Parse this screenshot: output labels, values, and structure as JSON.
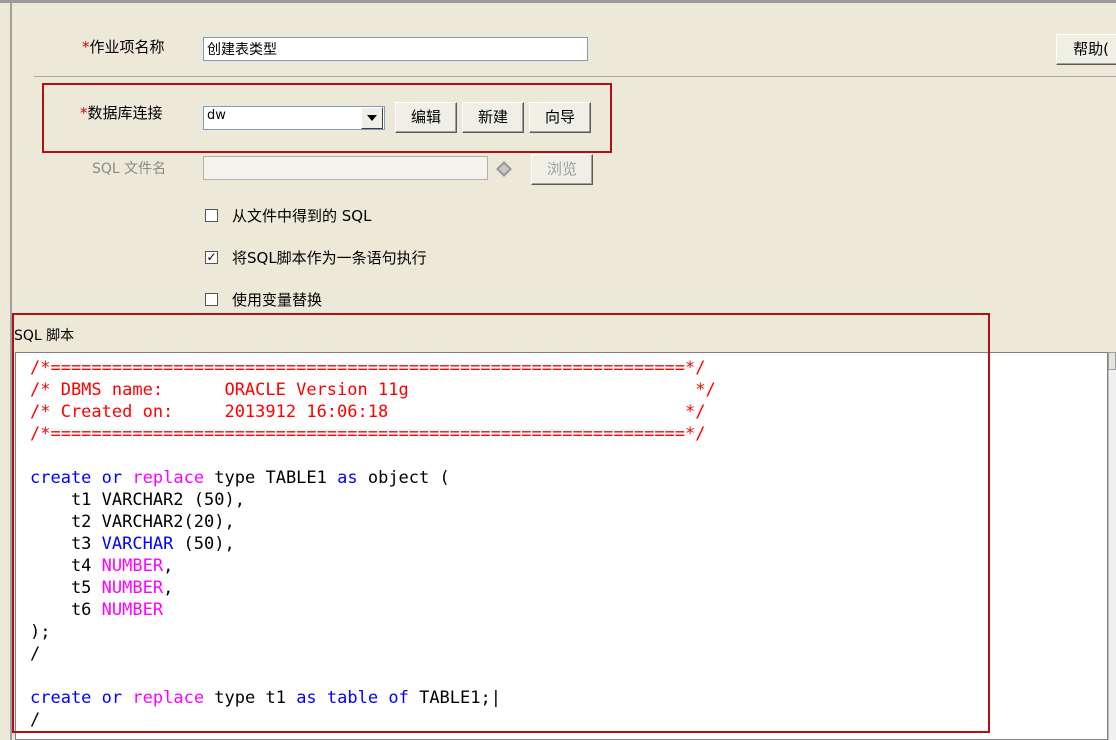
{
  "job": {
    "name_label": "作业项名称",
    "name_value": "创建表类型",
    "help_label": "帮助(",
    "required_mark": "*"
  },
  "db": {
    "label": "数据库连接",
    "selected": "dw",
    "edit_label": "编辑",
    "new_label": "新建",
    "wizard_label": "向导"
  },
  "sqlfile": {
    "label": "SQL 文件名",
    "value": "",
    "browse_label": "浏览"
  },
  "options": [
    {
      "label": "从文件中得到的 SQL",
      "checked": false
    },
    {
      "label": "将SQL脚本作为一条语句执行",
      "checked": true
    },
    {
      "label": "使用变量替换",
      "checked": false
    }
  ],
  "script": {
    "label": "SQL 脚本",
    "lines": [
      [
        {
          "t": "/*==============================================================*/",
          "c": "comment"
        }
      ],
      [
        {
          "t": "/* DBMS name:      ORACLE Version 11g                            */",
          "c": "comment"
        }
      ],
      [
        {
          "t": "/* Created on:     2013912 16:06:18                             */",
          "c": "comment"
        }
      ],
      [
        {
          "t": "/*==============================================================*/",
          "c": "comment"
        }
      ],
      [],
      [
        {
          "t": "create",
          "c": "kw"
        },
        {
          "t": " ",
          "c": "plain"
        },
        {
          "t": "or",
          "c": "kw"
        },
        {
          "t": " ",
          "c": "plain"
        },
        {
          "t": "replace",
          "c": "kw2"
        },
        {
          "t": " type TABLE1 ",
          "c": "plain"
        },
        {
          "t": "as",
          "c": "kw"
        },
        {
          "t": " object (",
          "c": "plain"
        }
      ],
      [
        {
          "t": "    t1 VARCHAR2 (50),",
          "c": "plain"
        }
      ],
      [
        {
          "t": "    t2 VARCHAR2(20),",
          "c": "plain"
        }
      ],
      [
        {
          "t": "    t3 ",
          "c": "plain"
        },
        {
          "t": "VARCHAR",
          "c": "kw"
        },
        {
          "t": " (50),",
          "c": "plain"
        }
      ],
      [
        {
          "t": "    t4 ",
          "c": "plain"
        },
        {
          "t": "NUMBER",
          "c": "kw2"
        },
        {
          "t": ",",
          "c": "plain"
        }
      ],
      [
        {
          "t": "    t5 ",
          "c": "plain"
        },
        {
          "t": "NUMBER",
          "c": "kw2"
        },
        {
          "t": ",",
          "c": "plain"
        }
      ],
      [
        {
          "t": "    t6 ",
          "c": "plain"
        },
        {
          "t": "NUMBER",
          "c": "kw2"
        }
      ],
      [
        {
          "t": ");",
          "c": "plain"
        }
      ],
      [
        {
          "t": "/",
          "c": "plain"
        }
      ],
      [],
      [
        {
          "t": "create",
          "c": "kw"
        },
        {
          "t": " ",
          "c": "plain"
        },
        {
          "t": "or",
          "c": "kw"
        },
        {
          "t": " ",
          "c": "plain"
        },
        {
          "t": "replace",
          "c": "kw2"
        },
        {
          "t": " type t1 ",
          "c": "plain"
        },
        {
          "t": "as",
          "c": "kw"
        },
        {
          "t": " ",
          "c": "plain"
        },
        {
          "t": "table",
          "c": "kw"
        },
        {
          "t": " ",
          "c": "plain"
        },
        {
          "t": "of",
          "c": "kw"
        },
        {
          "t": " TABLE1;|",
          "c": "plain"
        }
      ],
      [
        {
          "t": "/",
          "c": "plain"
        }
      ]
    ]
  },
  "colors": {
    "highlight_box": "#b01010",
    "comment": "#ff0000",
    "keyword": "#0000ff",
    "keyword2": "#ff00ff"
  }
}
